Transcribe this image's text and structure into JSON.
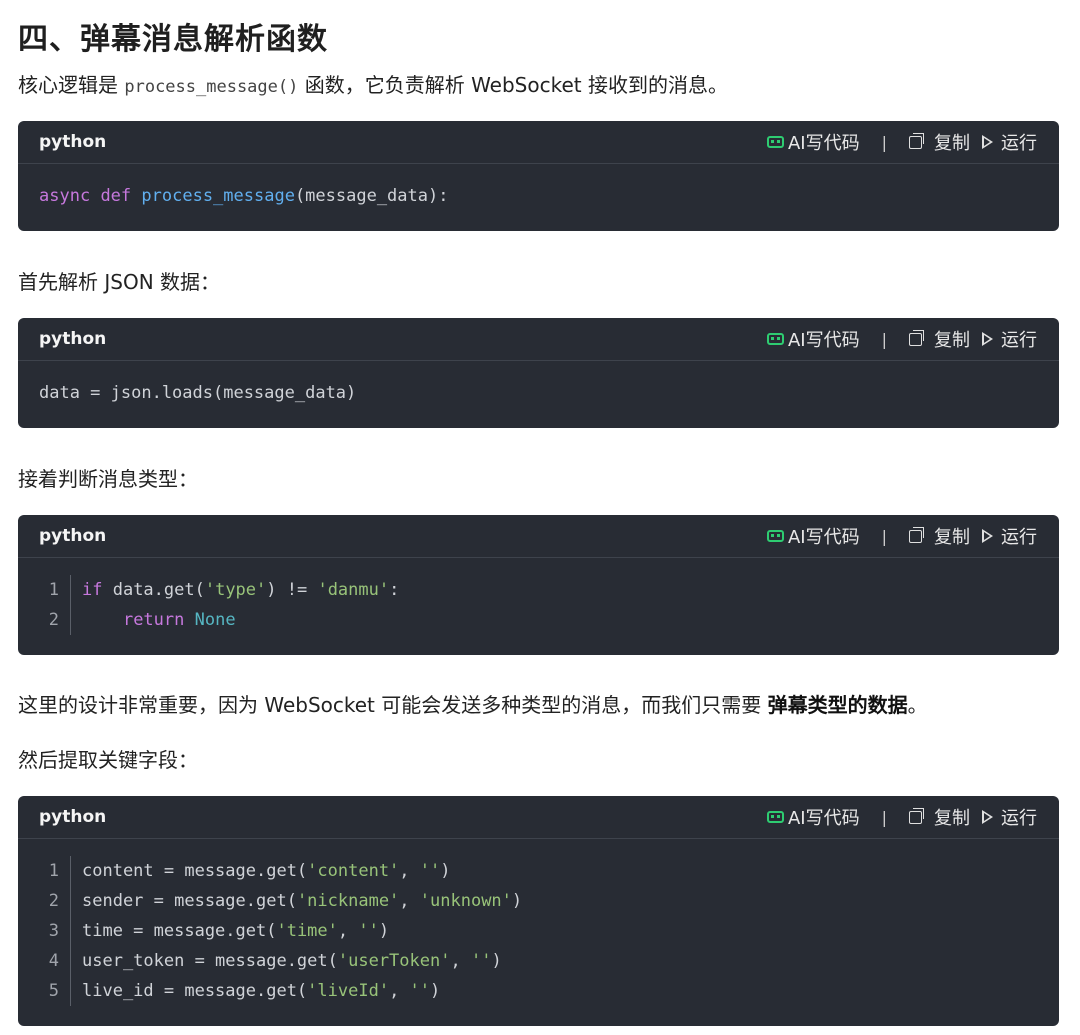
{
  "heading": "四、弹幕消息解析函数",
  "intro": {
    "prefix": "核心逻辑是 ",
    "code": "process_message()",
    "suffix": " 函数，它负责解析 WebSocket 接收到的消息。"
  },
  "toolbar": {
    "lang": "python",
    "ai_label": "AI写代码",
    "separator": "|",
    "copy_label": "复制",
    "run_label": "运行"
  },
  "block1": {
    "line1": [
      {
        "t": "async",
        "c": "kw"
      },
      {
        "t": " ",
        "c": ""
      },
      {
        "t": "def",
        "c": "kw"
      },
      {
        "t": " ",
        "c": ""
      },
      {
        "t": "process_message",
        "c": "fn"
      },
      {
        "t": "(message_data):",
        "c": ""
      }
    ]
  },
  "para2": "首先解析 JSON 数据：",
  "block2": {
    "line1": [
      {
        "t": "data = json.loads(message_data)",
        "c": ""
      }
    ]
  },
  "para3": "接着判断消息类型：",
  "block3": {
    "lines": [
      {
        "n": "1",
        "tokens": [
          {
            "t": "if",
            "c": "kw"
          },
          {
            "t": " data.get(",
            "c": ""
          },
          {
            "t": "'type'",
            "c": "str"
          },
          {
            "t": ") != ",
            "c": ""
          },
          {
            "t": "'danmu'",
            "c": "str"
          },
          {
            "t": ":",
            "c": ""
          }
        ]
      },
      {
        "n": "2",
        "tokens": [
          {
            "t": "    ",
            "c": ""
          },
          {
            "t": "return",
            "c": "kw"
          },
          {
            "t": " ",
            "c": ""
          },
          {
            "t": "None",
            "c": "const"
          }
        ]
      }
    ]
  },
  "para4": {
    "prefix": "这里的设计非常重要，因为 WebSocket 可能会发送多种类型的消息，而我们只需要 ",
    "bold": "弹幕类型的数据",
    "suffix": "。"
  },
  "para5": "然后提取关键字段：",
  "block4": {
    "lines": [
      {
        "n": "1",
        "tokens": [
          {
            "t": "content = message.get(",
            "c": ""
          },
          {
            "t": "'content'",
            "c": "str"
          },
          {
            "t": ", ",
            "c": ""
          },
          {
            "t": "''",
            "c": "str"
          },
          {
            "t": ")",
            "c": ""
          }
        ]
      },
      {
        "n": "2",
        "tokens": [
          {
            "t": "sender = message.get(",
            "c": ""
          },
          {
            "t": "'nickname'",
            "c": "str"
          },
          {
            "t": ", ",
            "c": ""
          },
          {
            "t": "'unknown'",
            "c": "str"
          },
          {
            "t": ")",
            "c": ""
          }
        ]
      },
      {
        "n": "3",
        "tokens": [
          {
            "t": "time = message.get(",
            "c": ""
          },
          {
            "t": "'time'",
            "c": "str"
          },
          {
            "t": ", ",
            "c": ""
          },
          {
            "t": "''",
            "c": "str"
          },
          {
            "t": ")",
            "c": ""
          }
        ]
      },
      {
        "n": "4",
        "tokens": [
          {
            "t": "user_token = message.get(",
            "c": ""
          },
          {
            "t": "'userToken'",
            "c": "str"
          },
          {
            "t": ", ",
            "c": ""
          },
          {
            "t": "''",
            "c": "str"
          },
          {
            "t": ")",
            "c": ""
          }
        ]
      },
      {
        "n": "5",
        "tokens": [
          {
            "t": "live_id = message.get(",
            "c": ""
          },
          {
            "t": "'liveId'",
            "c": "str"
          },
          {
            "t": ", ",
            "c": ""
          },
          {
            "t": "''",
            "c": "str"
          },
          {
            "t": ")",
            "c": ""
          }
        ]
      }
    ]
  },
  "colors": {
    "code_bg": "#282c34",
    "keyword": "#c678dd",
    "function": "#61afef",
    "string": "#98c379",
    "constant": "#56b6c2",
    "ai_icon": "#2ecc71"
  }
}
